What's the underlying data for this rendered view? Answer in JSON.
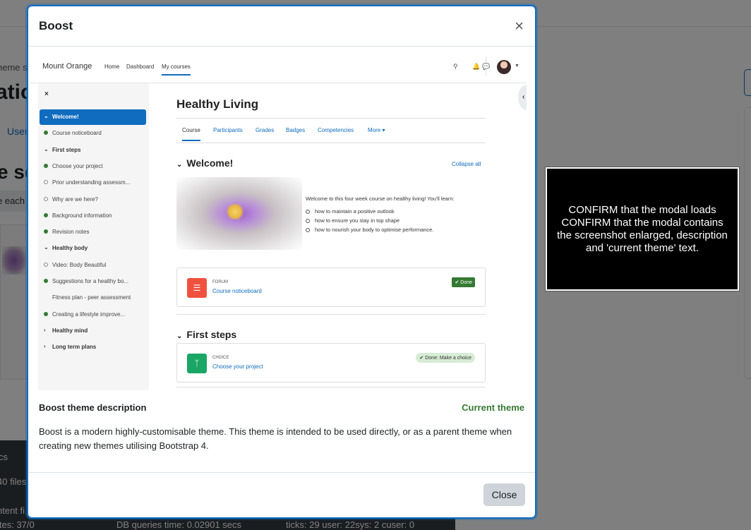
{
  "background": {
    "breadcrumb_fragment": "heme s",
    "heading_fragment": "atio",
    "tab_fragment": "User",
    "heading2_fragment": "e se",
    "bar_fragment": "e each",
    "footer": {
      "line1": "cs",
      "line2": "40 files",
      "line3": "ntent fi",
      "line4": "ites: 37/0",
      "line5": "DB queries time: 0.02901 secs",
      "line6": "ticks: 29 user: 22sys: 2 cuser: 0"
    }
  },
  "modal": {
    "title": "Boost",
    "close_x": "×",
    "description_title": "Boost theme description",
    "current_theme": "Current theme",
    "description": "Boost is a modern highly-customisable theme. This theme is intended to be used directly, or as a parent theme when creating new themes utilising Bootstrap 4.",
    "close_button": "Close"
  },
  "screenshot": {
    "site_name": "Mount Orange",
    "nav_links": [
      "Home",
      "Dashboard",
      "My courses"
    ],
    "drawer_close": "×",
    "drawer_items": [
      {
        "label": "Welcome!",
        "kind": "section-active"
      },
      {
        "label": "Course noticeboard",
        "kind": "done"
      },
      {
        "label": "First steps",
        "kind": "section"
      },
      {
        "label": "Choose your project",
        "kind": "done"
      },
      {
        "label": "Prior understanding assessm...",
        "kind": "todo"
      },
      {
        "label": "Why are we here?",
        "kind": "todo"
      },
      {
        "label": "Background information",
        "kind": "done"
      },
      {
        "label": "Revision notes",
        "kind": "done"
      },
      {
        "label": "Healthy body",
        "kind": "section"
      },
      {
        "label": "Video: Body Beautiful",
        "kind": "todo"
      },
      {
        "label": "Suggestions for a healthy bo...",
        "kind": "done"
      },
      {
        "label": "Fitness plan - peer assessment",
        "kind": "none"
      },
      {
        "label": "Creating a lifestyle improve...",
        "kind": "done"
      },
      {
        "label": "Healthy mind",
        "kind": "section-collapsed"
      },
      {
        "label": "Long term plans",
        "kind": "section-collapsed"
      }
    ],
    "course_title": "Healthy Living",
    "tabs": [
      "Course",
      "Participants",
      "Grades",
      "Badges",
      "Competencies",
      "More ▾"
    ],
    "section1": "Welcome!",
    "collapse_all": "Collapse all",
    "intro": "Welcome to this four week course on healthy living! You'll learn:",
    "bullets": [
      "how to maintain a positive outlook",
      "how to ensure you stay in top shape",
      "how to nourish your body to optimise performance."
    ],
    "forum_type": "FORUM",
    "forum_name": "Course noticeboard",
    "forum_status": "✔ Done",
    "section2": "First steps",
    "choice_type": "CHOICE",
    "choice_name": "Choose your project",
    "choice_status": "✔ Done: Make a choice"
  },
  "note": {
    "text": "CONFIRM that the modal loads CONFIRM that the modal contains the screenshot enlarged, description and 'current theme' text."
  },
  "colors": {
    "accent": "#0f6cbf",
    "success": "#357a32",
    "footer_bg": "#343a40"
  }
}
